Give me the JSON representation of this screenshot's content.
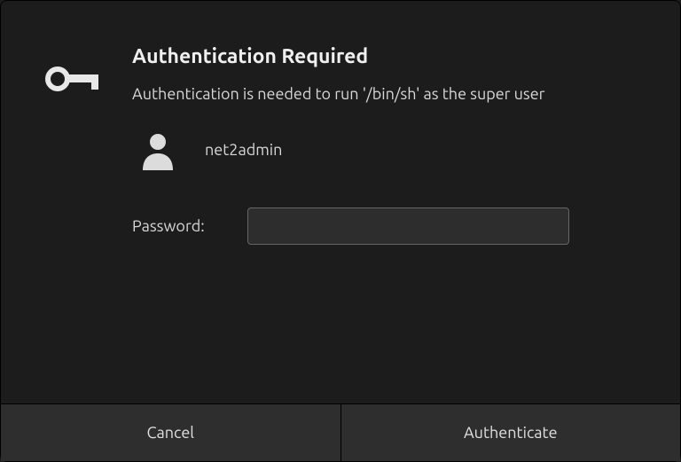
{
  "dialog": {
    "title": "Authentication Required",
    "message": "Authentication is needed to run '/bin/sh' as the super user",
    "user": {
      "name": "net2admin"
    },
    "password": {
      "label": "Password:",
      "value": ""
    },
    "buttons": {
      "cancel": "Cancel",
      "authenticate": "Authenticate"
    }
  }
}
